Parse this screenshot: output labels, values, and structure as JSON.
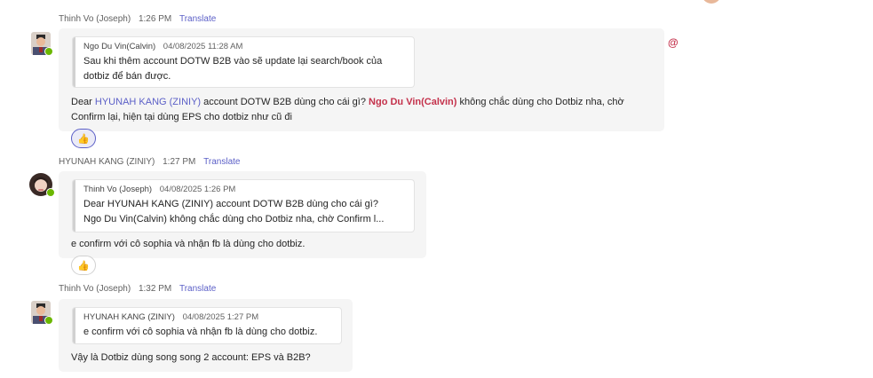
{
  "messages": [
    {
      "sender": "Thinh Vo (Joseph)",
      "time": "1:26 PM",
      "translate_label": "Translate",
      "quote": {
        "author": "Ngo Du Vin(Calvin)",
        "datetime": "04/08/2025 11:28 AM",
        "line1": "Sau khi thêm account DOTW B2B vào sẽ update lại search/book của",
        "line2": "dotbiz để bán được."
      },
      "body": {
        "prefix": "Dear ",
        "mention1": "HYUNAH KANG (ZINIY)",
        "middle": " account DOTW B2B dùng cho cái gì? ",
        "mention2": "Ngo Du Vin(Calvin)",
        "suffix": " không chắc dùng cho Dotbiz nha, chờ",
        "line2": "Confirm lại, hiện tại dùng EPS cho dotbiz như cũ đi"
      },
      "reaction": "👍",
      "mention_marker": "@"
    },
    {
      "sender": "HYUNAH KANG (ZINIY)",
      "time": "1:27 PM",
      "translate_label": "Translate",
      "quote": {
        "author": "Thinh Vo (Joseph)",
        "datetime": "04/08/2025 1:26 PM",
        "line1": "Dear HYUNAH KANG (ZINIY) account DOTW B2B dùng cho cái gì?",
        "line2": "Ngo Du Vin(Calvin) không chắc dùng cho Dotbiz nha, chờ Confirm l..."
      },
      "body": {
        "text": "e confirm với cô sophia và nhận fb là dùng cho dotbiz."
      },
      "reaction": "👍"
    },
    {
      "sender": "Thinh Vo (Joseph)",
      "time": "1:32 PM",
      "translate_label": "Translate",
      "quote": {
        "author": "HYUNAH KANG (ZINIY)",
        "datetime": "04/08/2025 1:27 PM",
        "line1": "e confirm với cô sophia và nhận fb là dùng cho dotbiz."
      },
      "body": {
        "text": "Vậy là Dotbiz dùng song song 2 account: EPS và B2B?"
      }
    }
  ],
  "colors": {
    "accent": "#5b5fc7",
    "mention_self": "#c4314b",
    "presence": "#6bb700",
    "bubble": "#f5f5f5"
  }
}
